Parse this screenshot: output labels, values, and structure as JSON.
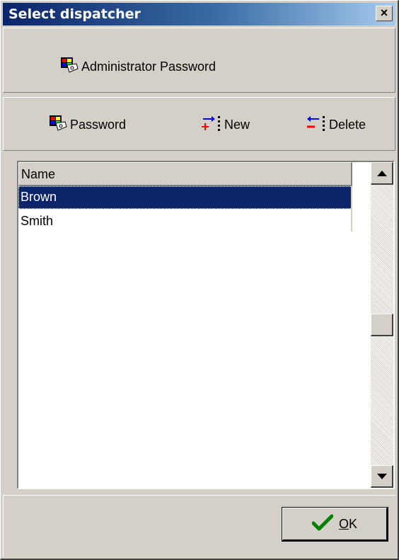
{
  "window": {
    "title": "Select dispatcher",
    "close_glyph": "×"
  },
  "admin_toolbar": {
    "admin_password_label": "Administrator Password",
    "icon": "key-card-icon"
  },
  "toolbar": {
    "password_label": "Password",
    "new_label": "New",
    "delete_label": "Delete",
    "icons": {
      "password": "key-card-icon",
      "new": "add-row-icon",
      "delete": "delete-row-icon"
    }
  },
  "list": {
    "column_header": "Name",
    "rows": [
      "Brown",
      "Smith"
    ],
    "selected_index": 0
  },
  "footer": {
    "ok_label_first": "O",
    "ok_label_rest": "K",
    "icon": "checkmark-icon"
  },
  "colors": {
    "title_bar": "#0a246a",
    "selection": "#0a246a",
    "face": "#d4d0c8"
  }
}
